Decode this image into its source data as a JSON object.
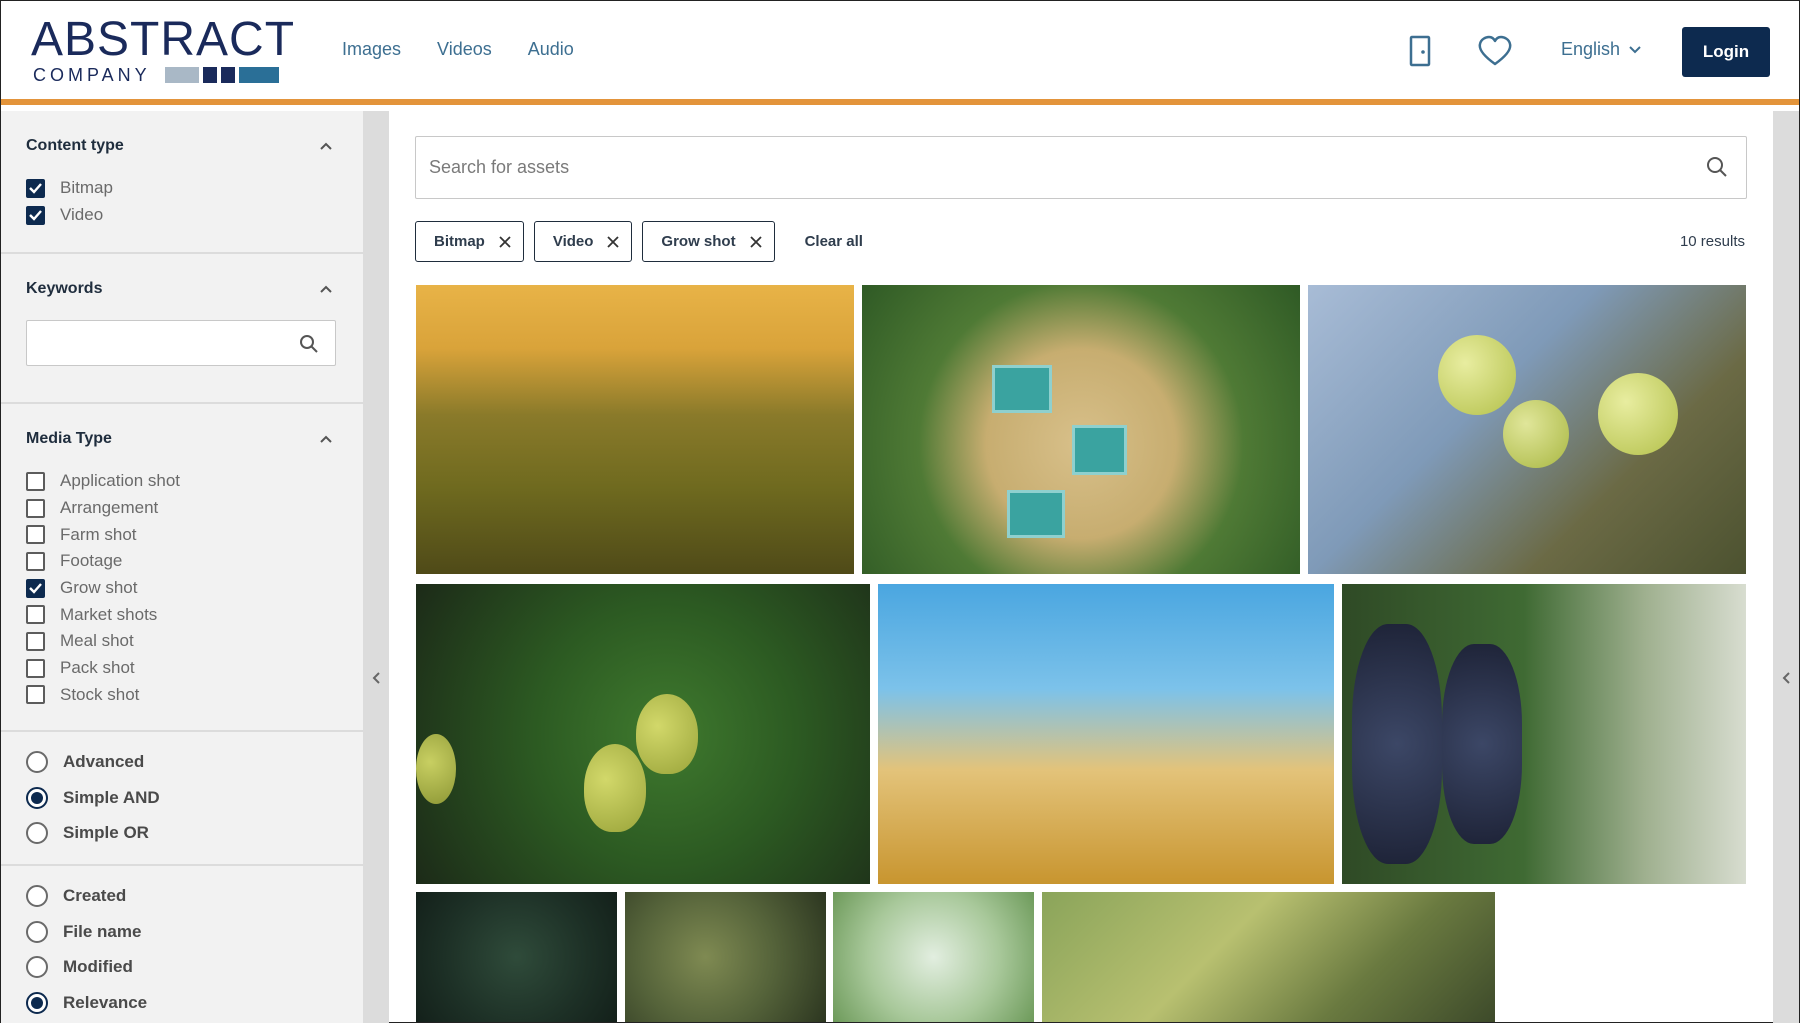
{
  "logo": {
    "line1": "ABSTRACT",
    "line2": "COMPANY",
    "bar_colors": [
      "#a9b8c6",
      "#1a2a5b",
      "#1a2a5b",
      "#2a6f97"
    ]
  },
  "nav": [
    "Images",
    "Videos",
    "Audio"
  ],
  "header": {
    "language": "English",
    "login_label": "Login",
    "icons": [
      "door-icon",
      "heart-icon"
    ]
  },
  "colors": {
    "accent": "#e3943b",
    "primary": "#0d2a4f",
    "link": "#3d6f91"
  },
  "filters": {
    "content_type": {
      "title": "Content type",
      "options": [
        {
          "label": "Bitmap",
          "checked": true
        },
        {
          "label": "Video",
          "checked": true
        }
      ]
    },
    "keywords": {
      "title": "Keywords",
      "value": ""
    },
    "media_type": {
      "title": "Media Type",
      "options": [
        {
          "label": "Application shot",
          "checked": false
        },
        {
          "label": "Arrangement",
          "checked": false
        },
        {
          "label": "Farm shot",
          "checked": false
        },
        {
          "label": "Footage",
          "checked": false
        },
        {
          "label": "Grow shot",
          "checked": true
        },
        {
          "label": "Market shots",
          "checked": false
        },
        {
          "label": "Meal shot",
          "checked": false
        },
        {
          "label": "Pack shot",
          "checked": false
        },
        {
          "label": "Stock shot",
          "checked": false
        }
      ]
    },
    "match_mode": [
      {
        "label": "Advanced",
        "selected": false
      },
      {
        "label": "Simple AND",
        "selected": true
      },
      {
        "label": "Simple OR",
        "selected": false
      }
    ],
    "sort": [
      {
        "label": "Created",
        "selected": false
      },
      {
        "label": "File name",
        "selected": false
      },
      {
        "label": "Modified",
        "selected": false
      },
      {
        "label": "Relevance",
        "selected": true
      }
    ]
  },
  "search": {
    "placeholder": "Search for assets",
    "value": ""
  },
  "chips": [
    "Bitmap",
    "Video",
    "Grow shot"
  ],
  "clear_all": "Clear all",
  "results": "10 results",
  "thumbnails": [
    "golden field at sunset",
    "strawberry picking",
    "green apples on branch",
    "pears on tree",
    "wheat against blue sky",
    "dark grapes on vine",
    "blueberry bush",
    "fruit tree branches",
    "green leaves closeup",
    "vineyard foliage"
  ]
}
